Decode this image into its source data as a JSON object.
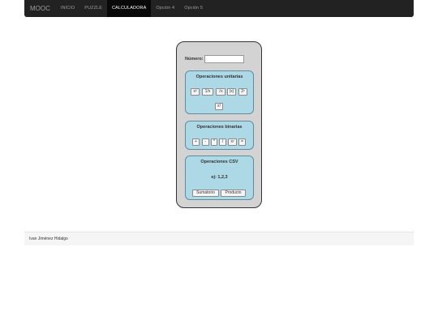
{
  "navbar": {
    "brand": "MOOC",
    "items": [
      {
        "label": "INICIO",
        "active": false
      },
      {
        "label": "PUZZLE",
        "active": false
      },
      {
        "label": "CALCULADORA",
        "active": true
      },
      {
        "label": "Opción 4",
        "active": false
      },
      {
        "label": "Opción 5",
        "active": false
      }
    ]
  },
  "calculator": {
    "number_label": "Número:",
    "number_value": "",
    "unary": {
      "title": "Operaciones unitarias",
      "buttons": [
        "x²",
        "1/x",
        "√x",
        "|x|",
        "2ˣ",
        "x!"
      ]
    },
    "binary": {
      "title": "Operaciones binarias",
      "buttons": [
        "+",
        "-",
        "*",
        "/",
        "xʸ",
        "="
      ]
    },
    "csv": {
      "title": "Operaciones CSV",
      "example": "ej: 1,2,3",
      "buttons": [
        "Sumatorio",
        "Producto"
      ]
    }
  },
  "footer": {
    "text": "Ivan Jiménez Hidalgo"
  }
}
